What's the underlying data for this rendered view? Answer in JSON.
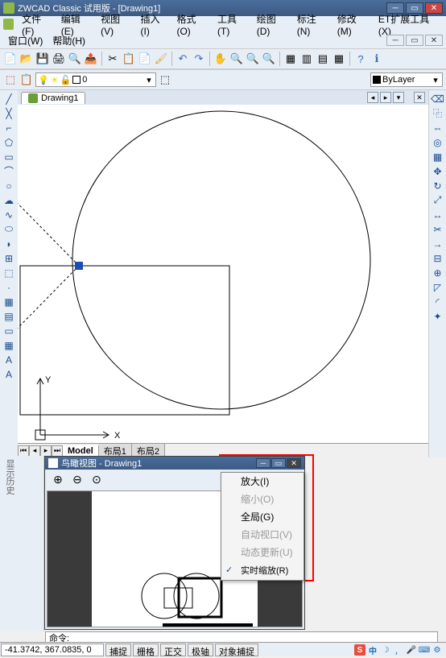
{
  "title": "ZWCAD Classic 试用版 - [Drawing1]",
  "menubar": [
    "文件(F)",
    "编辑(E)",
    "视图(V)",
    "插入(I)",
    "格式(O)",
    "工具(T)",
    "绘图(D)",
    "标注(N)",
    "修改(M)",
    "ET扩展工具(X)"
  ],
  "menubar2": [
    "窗口(W)",
    "帮助(H)"
  ],
  "doctab": "Drawing1",
  "layer_combo": "ByLayer",
  "layer_combo_layer": "0",
  "layouttabs": {
    "active": "Model",
    "others": [
      "布局1",
      "布局2"
    ]
  },
  "aerial": {
    "title": "鸟瞰视图 - Drawing1"
  },
  "context_menu": [
    {
      "label": "放大(I)",
      "enabled": true
    },
    {
      "label": "缩小(O)",
      "enabled": false
    },
    {
      "label": "全局(G)",
      "enabled": true
    },
    {
      "label": "自动视口(V)",
      "enabled": false
    },
    {
      "label": "动态更新(U)",
      "enabled": false
    },
    {
      "label": "实时缩放(R)",
      "enabled": true,
      "checked": true
    }
  ],
  "cmdprompt": "命令:",
  "coords": "-41.3742, 367.0835, 0",
  "status_btns": [
    "捕捉",
    "栅格",
    "正交",
    "极轴",
    "对象捕捉"
  ],
  "ime": {
    "badge": "S",
    "lang": "中"
  }
}
